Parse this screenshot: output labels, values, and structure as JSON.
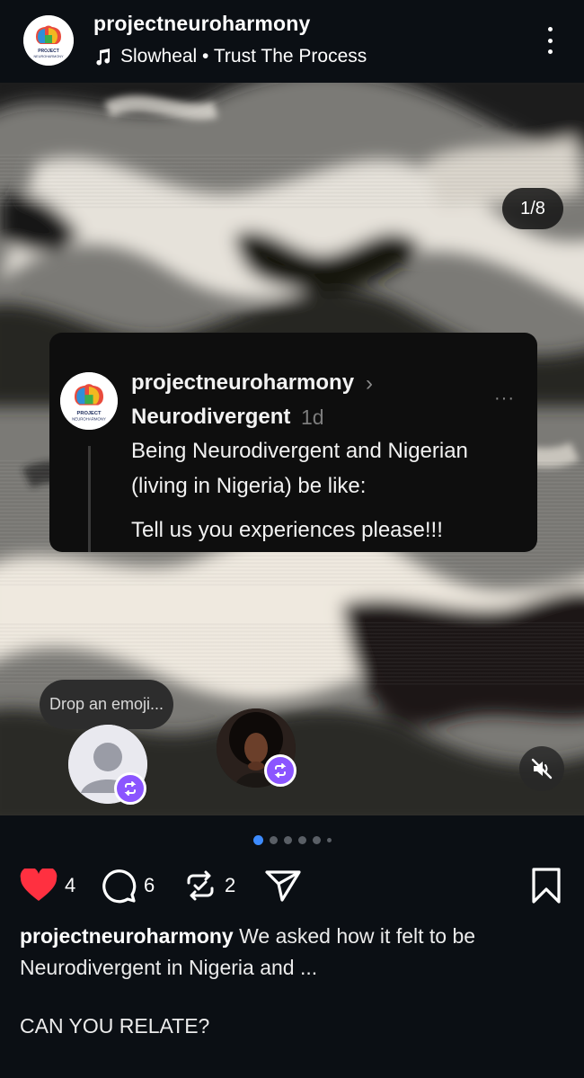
{
  "header": {
    "username": "projectneuroharmony",
    "music": "Slowheal • Trust The Process",
    "avatar_text": "PROJECT NEUROHARMONY"
  },
  "media": {
    "counter": "1/8",
    "quote": {
      "username": "projectneuroharmony",
      "chevron": "›",
      "group": "Neurodivergent",
      "time": "1d",
      "more": "···",
      "line1": "Being Neurodivergent and Nigerian",
      "line2": "(living in Nigeria) be like:",
      "line3": "Tell us you experiences please!!!"
    },
    "emoji_prompt": "Drop an emoji..."
  },
  "pagination": {
    "total_visible": 6,
    "active_index": 0
  },
  "actions": {
    "likes": "4",
    "comments": "6",
    "reposts": "2"
  },
  "caption": {
    "username": "projectneuroharmony",
    "text": " We asked how it felt to be Neurodivergent in Nigeria and ...",
    "line2": "CAN YOU RELATE?"
  },
  "colors": {
    "background": "#0b0f14",
    "like": "#ff3040",
    "badge": "#8b55ff",
    "active_dot": "#3d8bff"
  },
  "icons": [
    "music-note-icon",
    "more-vertical-icon",
    "chevron-right-icon",
    "mute-icon",
    "repost-icon",
    "heart-icon",
    "comment-icon",
    "share-icon",
    "bookmark-icon"
  ]
}
